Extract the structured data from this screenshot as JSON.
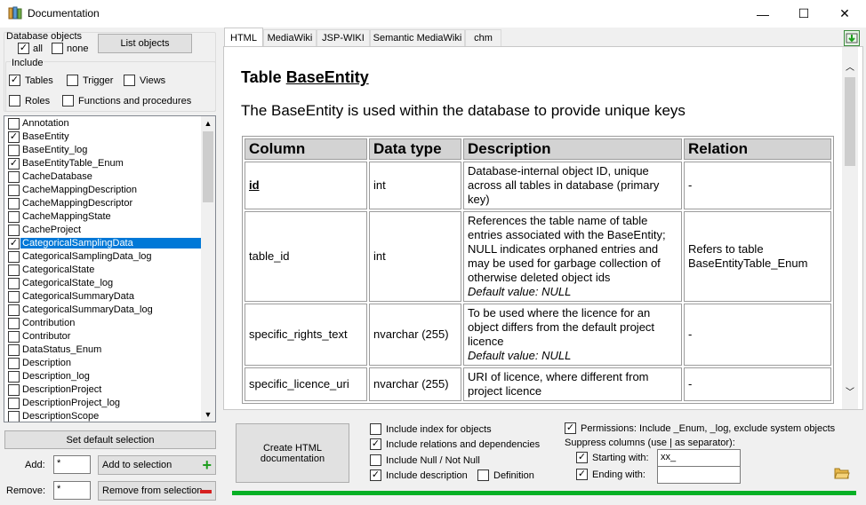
{
  "window": {
    "title": "Documentation",
    "minimize": "—",
    "maximize": "☐",
    "close": "✕"
  },
  "left": {
    "db_objects_label": "Database objects",
    "all_label": "all",
    "none_label": "none",
    "list_objects_button": "List objects",
    "include_label": "Include",
    "tables_label": "Tables",
    "trigger_label": "Trigger",
    "views_label": "Views",
    "roles_label": "Roles",
    "functions_label": "Functions and procedures",
    "items": [
      {
        "label": "Annotation",
        "checked": false
      },
      {
        "label": "BaseEntity",
        "checked": true
      },
      {
        "label": "BaseEntity_log",
        "checked": false
      },
      {
        "label": "BaseEntityTable_Enum",
        "checked": true
      },
      {
        "label": "CacheDatabase",
        "checked": false
      },
      {
        "label": "CacheMappingDescription",
        "checked": false
      },
      {
        "label": "CacheMappingDescriptor",
        "checked": false
      },
      {
        "label": "CacheMappingState",
        "checked": false
      },
      {
        "label": "CacheProject",
        "checked": false
      },
      {
        "label": "CategoricalSamplingData",
        "checked": true,
        "selected": true
      },
      {
        "label": "CategoricalSamplingData_log",
        "checked": false
      },
      {
        "label": "CategoricalState",
        "checked": false
      },
      {
        "label": "CategoricalState_log",
        "checked": false
      },
      {
        "label": "CategoricalSummaryData",
        "checked": false
      },
      {
        "label": "CategoricalSummaryData_log",
        "checked": false
      },
      {
        "label": "Contribution",
        "checked": false
      },
      {
        "label": "Contributor",
        "checked": false
      },
      {
        "label": "DataStatus_Enum",
        "checked": false
      },
      {
        "label": "Description",
        "checked": false
      },
      {
        "label": "Description_log",
        "checked": false
      },
      {
        "label": "DescriptionProject",
        "checked": false
      },
      {
        "label": "DescriptionProject_log",
        "checked": false
      },
      {
        "label": "DescriptionScope",
        "checked": false
      }
    ],
    "set_default_button": "Set default selection",
    "add_label": "Add:",
    "add_value": "*",
    "add_button": "Add to selection",
    "remove_label": "Remove:",
    "remove_value": "*",
    "remove_button": "Remove from selection"
  },
  "tabs": [
    "HTML",
    "MediaWiki",
    "JSP-WIKI",
    "Semantic MediaWiki",
    "chm"
  ],
  "doc": {
    "title_prefix": "Table ",
    "title_name": "BaseEntity",
    "description": "The BaseEntity is used within the database to provide unique keys",
    "headers": [
      "Column",
      "Data type",
      "Description",
      "Relation"
    ],
    "rows": [
      {
        "column": "id",
        "type": "int",
        "desc": "Database-internal object ID, unique across all tables in database (primary key)",
        "default": "",
        "relation": "-"
      },
      {
        "column": "table_id",
        "type": "int",
        "desc": "References the table name of table entries associated with the BaseEntity; NULL indicates orphaned entries and may be used for garbage collection of otherwise deleted object ids",
        "default": "Default value: NULL",
        "relation": "Refers to table BaseEntityTable_Enum"
      },
      {
        "column": "specific_rights_text",
        "type": "nvarchar (255)",
        "desc": "To be used where the licence for an object differs from the default project licence",
        "default": "Default value: NULL",
        "relation": "-"
      },
      {
        "column": "specific_licence_uri",
        "type": "nvarchar (255)",
        "desc": "URI of licence, where different from project licence",
        "default": "",
        "relation": "-"
      }
    ]
  },
  "bottom": {
    "create_button": "Create HTML documentation",
    "include_index": "Include index for objects",
    "include_relations": "Include relations and dependencies",
    "include_null": "Include Null / Not Null",
    "include_description": "Include description",
    "definition": "Definition",
    "permissions": "Permissions: Include _Enum, _log, exclude system objects",
    "suppress_label": "Suppress columns (use | as separator):",
    "starting_with": "Starting with:",
    "starting_value": "xx_",
    "ending_with": "Ending with:",
    "ending_value": ""
  }
}
